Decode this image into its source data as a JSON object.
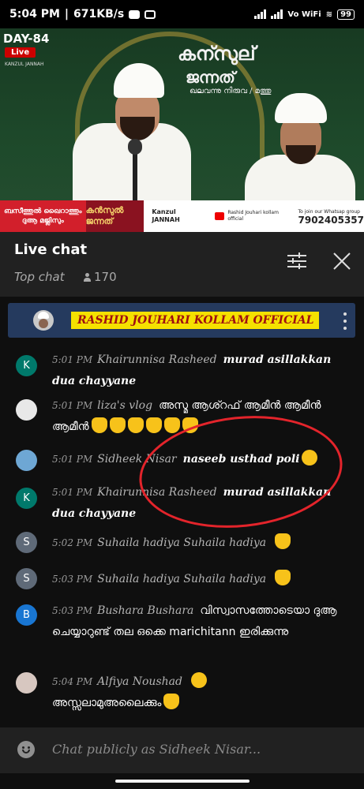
{
  "status_bar": {
    "time": "5:04 PM",
    "speed": "671KB/s",
    "network": "Vo WiFi",
    "battery": "99"
  },
  "video": {
    "day_label": "DAY-84",
    "live_label": "Live",
    "channel_small": "KANZUL JANNAH",
    "title_line1": "കന്സുല്",
    "title_line2": "ജന്നത്",
    "title_line3": "ഖലവന്നു നിരുവ / മത്തു",
    "banner_red": "ബസീത്തുൽ ഖൈറാത്തും ദുആ മജ്ലിസും",
    "banner_logo": "കൻസുൽ ജന്നത്",
    "banner_brand": "Kanzul JANNAH",
    "banner_yt": "Rashid Jouhari kollam official",
    "banner_whatsapp_label": "To join our Whatsap group",
    "banner_phone": "7902405357"
  },
  "chat_header": {
    "title": "Live chat",
    "mode": "Top chat",
    "viewer_count": "170"
  },
  "pinned": {
    "text": "RASHID JOUHARI KOLLAM OFFICIAL"
  },
  "messages": [
    {
      "avatar": "K",
      "time": "5:01 PM",
      "author": "Khairunnisa Rasheed",
      "text": "murad asillakkan dua chayyane"
    },
    {
      "avatar": "",
      "time": "5:01 PM",
      "author": "liza's vlog",
      "text": "അസ്മ ആശ്റഫ് ആമീൻ ആമീൻ ആമീൻ"
    },
    {
      "avatar": "",
      "time": "5:01 PM",
      "author": "Sidheek Nisar",
      "text": "naseeb usthad poli"
    },
    {
      "avatar": "K",
      "time": "5:01 PM",
      "author": "Khairunnisa Rasheed",
      "text": "murad asillakkan dua chayyane"
    },
    {
      "avatar": "S",
      "time": "5:02 PM",
      "author": "Suhaila hadiya Suhaila hadiya",
      "text": ""
    },
    {
      "avatar": "S",
      "time": "5:03 PM",
      "author": "Suhaila hadiya Suhaila hadiya",
      "text": ""
    },
    {
      "avatar": "B",
      "time": "5:03 PM",
      "author": "Bushara Bushara",
      "text": "വിസ്വാസത്തോടെയാ ദുആ ചെയ്യാറുണ്ട് തല ഒക്കെ marichitann ഇരിക്കുന്നു"
    },
    {
      "avatar": "",
      "time": "5:04 PM",
      "author": "Alfiya Noushad",
      "text": "അസ്സലാമുഅലൈക്കും"
    }
  ],
  "composer": {
    "placeholder": "Chat publicly as Sidheek Nisar..."
  },
  "colors": {
    "annotation_circle": "#e3242b",
    "pinned_bg": "#253a5e",
    "pinned_highlight": "#f5e100"
  }
}
